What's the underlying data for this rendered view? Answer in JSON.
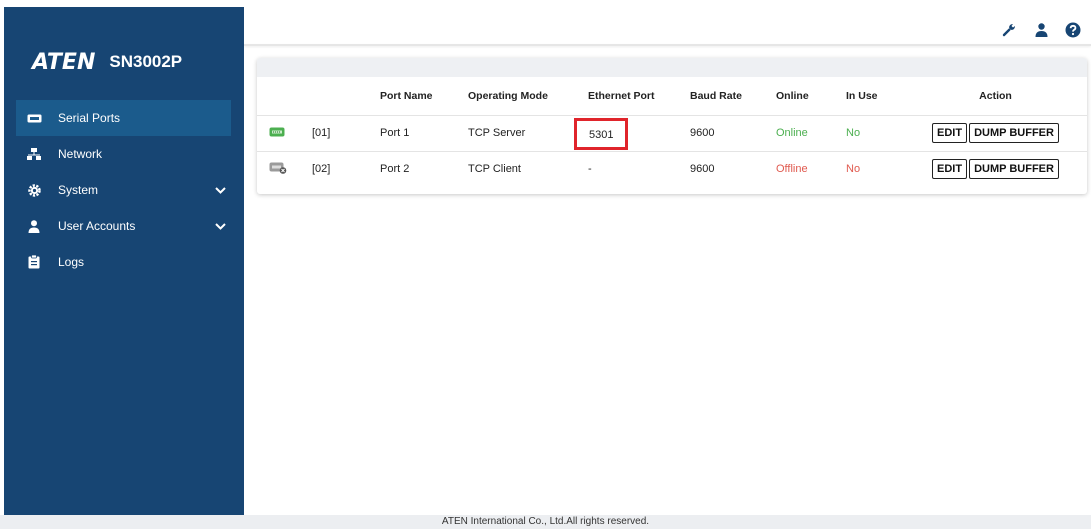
{
  "brand": {
    "logo": "ATEN",
    "model": "SN3002P"
  },
  "sidebar": {
    "items": [
      {
        "label": "Serial Ports",
        "icon": "serial-port-icon",
        "active": true
      },
      {
        "label": "Network",
        "icon": "network-icon"
      },
      {
        "label": "System",
        "icon": "gear-icon",
        "expandable": true
      },
      {
        "label": "User Accounts",
        "icon": "user-icon",
        "expandable": true
      },
      {
        "label": "Logs",
        "icon": "clipboard-icon"
      }
    ]
  },
  "topbar": {
    "icons": [
      "wrench-icon",
      "user-icon",
      "help-icon"
    ]
  },
  "table": {
    "headers": {
      "port_name": "Port Name",
      "operating_mode": "Operating Mode",
      "ethernet_port": "Ethernet Port",
      "baud_rate": "Baud Rate",
      "online": "Online",
      "in_use": "In Use",
      "action": "Action"
    },
    "rows": [
      {
        "id": "[01]",
        "name": "Port 1",
        "mode": "TCP Server",
        "eth": "5301",
        "baud": "9600",
        "online": "Online",
        "in_use": "No",
        "status_color": "#4caf50",
        "highlighted_eth": true
      },
      {
        "id": "[02]",
        "name": "Port 2",
        "mode": "TCP Client",
        "eth": "-",
        "baud": "9600",
        "online": "Offline",
        "in_use": "No",
        "status_color": "#e05a4f"
      }
    ],
    "actions": {
      "edit": "EDIT",
      "dump": "DUMP BUFFER"
    }
  },
  "footer": {
    "text": "ATEN International Co., Ltd.All rights reserved."
  },
  "colors": {
    "sidebar_bg": "#174573",
    "sidebar_active": "#1b5b8c",
    "highlight": "#e0242b"
  }
}
